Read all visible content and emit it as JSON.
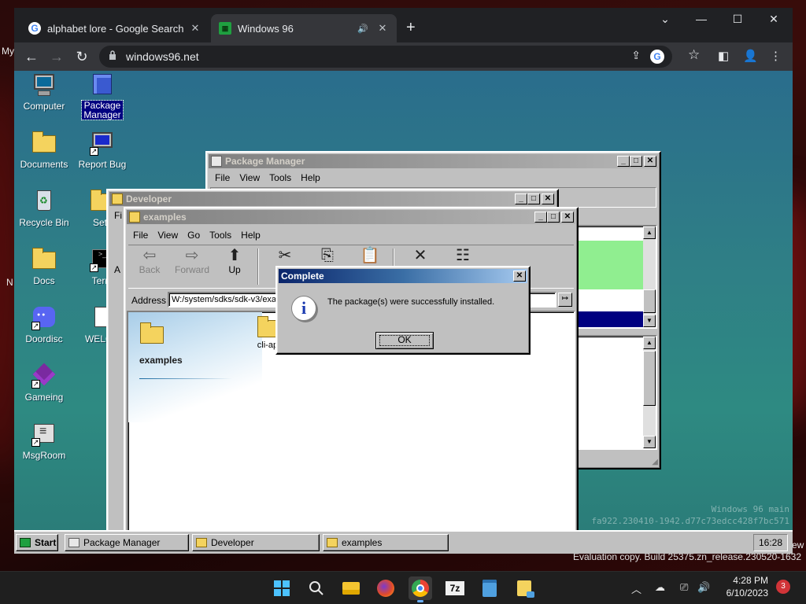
{
  "host": {
    "edge_left_label_1": "My",
    "edge_left_label_2": "N",
    "edge_right_label": "ew",
    "evaluation_text": "Evaluation copy. Build 25375.zn_release.230520-1632"
  },
  "browser": {
    "tabs": [
      {
        "title": "alphabet lore - Google Search",
        "favicon": "google-icon"
      },
      {
        "title": "Windows 96",
        "favicon": "windows96-icon",
        "audio": true
      }
    ],
    "url": "windows96.net"
  },
  "desktop": {
    "icons": [
      {
        "label": "Computer",
        "icon": "computer-icon"
      },
      {
        "label": "Package\nManager",
        "icon": "package-icon"
      },
      {
        "label": "Documents",
        "icon": "folder-icon"
      },
      {
        "label": "Report Bug",
        "icon": "bug-report-icon"
      },
      {
        "label": "Recycle Bin",
        "icon": "recycle-bin-icon"
      },
      {
        "label": "Setti",
        "icon": "settings-icon"
      },
      {
        "label": "Docs",
        "icon": "folder-icon"
      },
      {
        "label": "Term",
        "icon": "terminal-icon"
      },
      {
        "label": "Doordisc",
        "icon": "discord-icon"
      },
      {
        "label": "WELCO",
        "icon": "document-icon"
      },
      {
        "label": "Gameing",
        "icon": "cube-icon"
      },
      {
        "label": "MsgRoom",
        "icon": "chat-icon"
      }
    ]
  },
  "package_manager": {
    "title": "Package Manager",
    "menu": [
      "File",
      "View",
      "Tools",
      "Help"
    ]
  },
  "developer": {
    "title": "Developer",
    "menu_fragment": "Fi",
    "side_fragment": "A"
  },
  "explorer": {
    "title": "examples",
    "menu": [
      "File",
      "View",
      "Go",
      "Tools",
      "Help"
    ],
    "toolbar": [
      {
        "label": "Back",
        "glyph": "⇦",
        "enabled": false
      },
      {
        "label": "Forward",
        "glyph": "⇨",
        "enabled": false
      },
      {
        "label": "Up",
        "glyph": "⬆",
        "enabled": true
      },
      {
        "label": "",
        "glyph": "✂",
        "enabled": true
      },
      {
        "label": "",
        "glyph": "⎘",
        "enabled": true
      },
      {
        "label": "",
        "glyph": "📋",
        "enabled": true
      },
      {
        "label": "",
        "glyph": "✕",
        "enabled": true
      },
      {
        "label": "",
        "glyph": "☷",
        "enabled": true
      }
    ],
    "address_label": "Address",
    "address_value": "W:/system/sdks/sdk-v3/exa",
    "folder_heading": "examples",
    "items": [
      {
        "label": "cli-app"
      }
    ]
  },
  "dialog": {
    "title": "Complete",
    "message": "The package(s) were successfully installed.",
    "ok_label": "OK"
  },
  "w96_taskbar": {
    "start_label": "Start",
    "items": [
      "Package Manager",
      "Developer",
      "examples"
    ],
    "clock": "16:28"
  },
  "watermark": {
    "line1": "Windows 96 main",
    "line2": "fa922.230410-1942.d77c73edcc428f7bc571"
  },
  "host_taskbar": {
    "time": "4:28 PM",
    "date": "6/10/2023",
    "notifications": "3",
    "apps": [
      "windows-start-icon",
      "search-icon",
      "file-explorer-icon",
      "firefox-icon",
      "chrome-icon",
      "7zip-icon",
      "notepad-icon",
      "sticky-icon"
    ]
  },
  "colors": {
    "w96_active_title": "#0a246a",
    "w96_desktop": "#2e8a82",
    "selection": "#000080",
    "list_highlight": "#90ee90"
  }
}
